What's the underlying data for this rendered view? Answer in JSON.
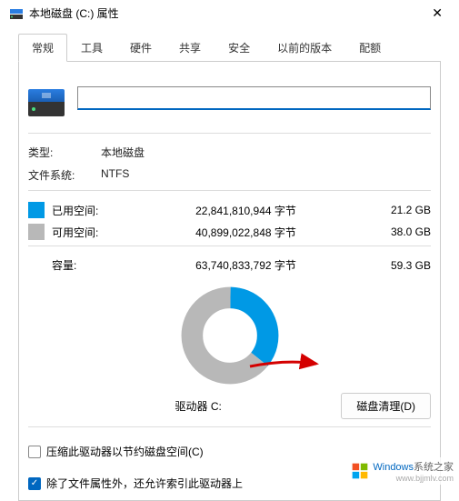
{
  "titlebar": {
    "title": "本地磁盘 (C:) 属性"
  },
  "tabs": [
    "常规",
    "工具",
    "硬件",
    "共享",
    "安全",
    "以前的版本",
    "配额"
  ],
  "drive": {
    "name_value": "",
    "type_label": "类型:",
    "type_value": "本地磁盘",
    "fs_label": "文件系统:",
    "fs_value": "NTFS"
  },
  "usage": {
    "used_label": "已用空间:",
    "used_bytes": "22,841,810,944 字节",
    "used_gb": "21.2 GB",
    "free_label": "可用空间:",
    "free_bytes": "40,899,022,848 字节",
    "free_gb": "38.0 GB",
    "capacity_label": "容量:",
    "capacity_bytes": "63,740,833,792 字节",
    "capacity_gb": "59.3 GB"
  },
  "chart_data": {
    "type": "pie",
    "title": "",
    "series": [
      {
        "name": "已用空间",
        "value": 21.2,
        "color": "#0099e5"
      },
      {
        "name": "可用空间",
        "value": 38.0,
        "color": "#b8b8b8"
      }
    ],
    "total": 59.3,
    "unit": "GB"
  },
  "drive_section": {
    "drive_label": "驱动器 C:",
    "cleanup_button": "磁盘清理(D)"
  },
  "checkboxes": {
    "compress": "压缩此驱动器以节约磁盘空间(C)",
    "index": "除了文件属性外，还允许索引此驱动器上"
  },
  "watermark": {
    "brand": "Windows",
    "suffix": "系统之家",
    "url": "www.bjjmlv.com"
  }
}
